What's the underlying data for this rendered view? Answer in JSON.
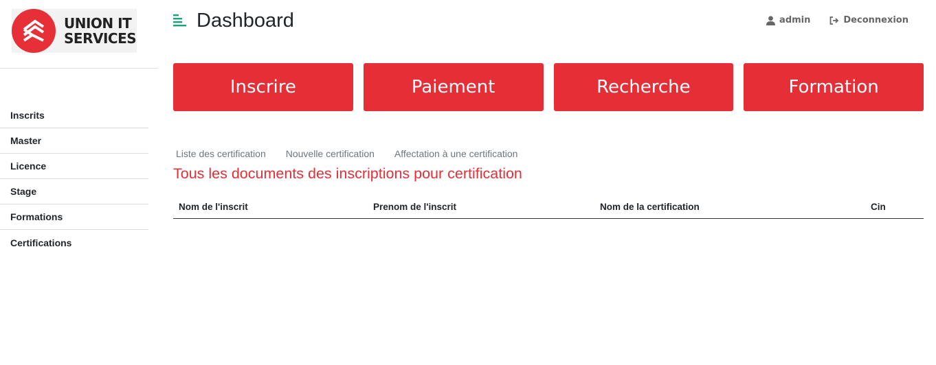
{
  "brand": {
    "line1": "UNION IT",
    "line2": "SERVICES",
    "accent": "#e62f37"
  },
  "sidebar": {
    "items": [
      {
        "label": "Inscrits"
      },
      {
        "label": "Master"
      },
      {
        "label": "Licence"
      },
      {
        "label": "Stage"
      },
      {
        "label": "Formations"
      },
      {
        "label": "Certifications"
      }
    ]
  },
  "header": {
    "menu_icon": "hamburger-icon",
    "title": "Dashboard",
    "user": {
      "icon": "user-icon",
      "label": "admin"
    },
    "logout": {
      "icon": "sign-out-icon",
      "label": "Deconnexion"
    }
  },
  "actions": [
    {
      "label": "Inscrire"
    },
    {
      "label": "Paiement"
    },
    {
      "label": "Recherche"
    },
    {
      "label": "Formation"
    }
  ],
  "subtabs": [
    {
      "label": "Liste des certification"
    },
    {
      "label": "Nouvelle certification"
    },
    {
      "label": "Affectation à une certification"
    }
  ],
  "section": {
    "title": "Tous les documents des inscriptions pour certification"
  },
  "table": {
    "columns": [
      "Nom de l'inscrit",
      "Prenom de l'inscrit",
      "Nom de la certification",
      "Cin"
    ],
    "rows": []
  },
  "colors": {
    "primary_red": "#e52e36",
    "menu_green": "#1aa37a"
  }
}
